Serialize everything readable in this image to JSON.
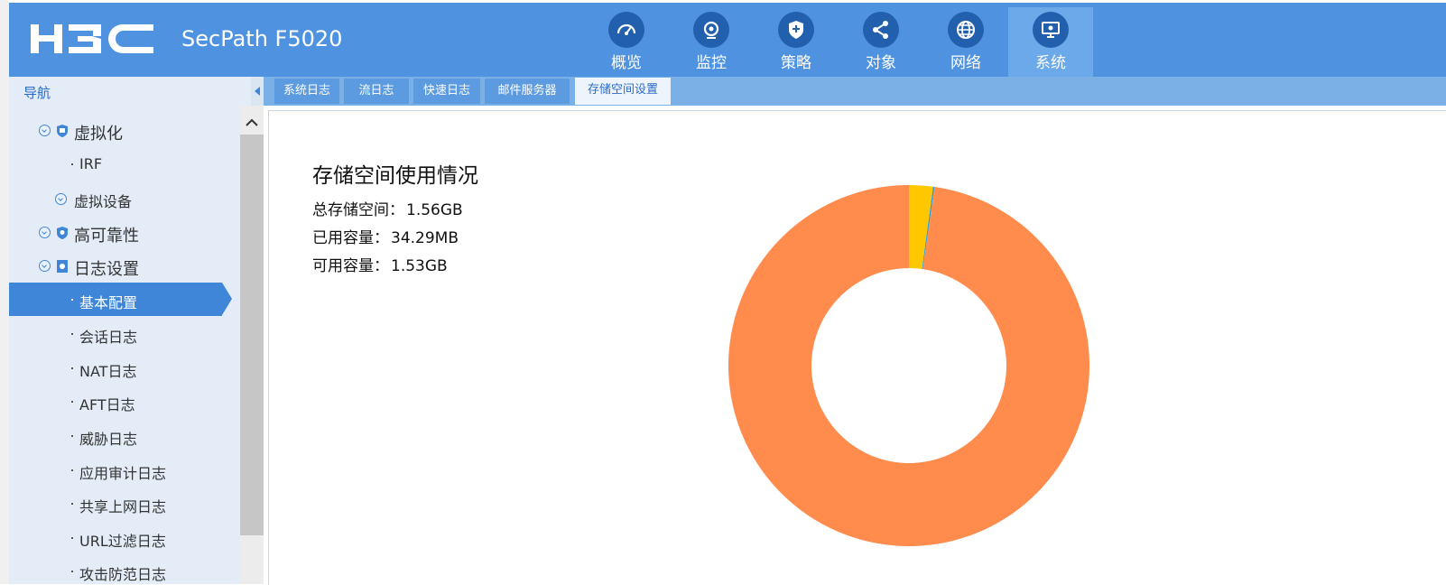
{
  "header": {
    "logo_text": "H3C",
    "product": "SecPath F5020",
    "nav": [
      {
        "label": "概览",
        "icon": "dashboard-icon"
      },
      {
        "label": "监控",
        "icon": "monitor-icon"
      },
      {
        "label": "策略",
        "icon": "shield-icon"
      },
      {
        "label": "对象",
        "icon": "share-icon"
      },
      {
        "label": "网络",
        "icon": "globe-icon"
      },
      {
        "label": "系统",
        "icon": "system-icon",
        "active": true
      }
    ]
  },
  "sidebar": {
    "title": "导航",
    "items": [
      {
        "label": "虚拟化",
        "type": "group"
      },
      {
        "label": "IRF",
        "type": "leaf"
      },
      {
        "label": "虚拟设备",
        "type": "subgroup"
      },
      {
        "label": "高可靠性",
        "type": "group"
      },
      {
        "label": "日志设置",
        "type": "group"
      },
      {
        "label": "基本配置",
        "type": "leaf",
        "active": true
      },
      {
        "label": "会话日志",
        "type": "leaf"
      },
      {
        "label": "NAT日志",
        "type": "leaf"
      },
      {
        "label": "AFT日志",
        "type": "leaf"
      },
      {
        "label": "威胁日志",
        "type": "leaf"
      },
      {
        "label": "应用审计日志",
        "type": "leaf"
      },
      {
        "label": "共享上网日志",
        "type": "leaf"
      },
      {
        "label": "URL过滤日志",
        "type": "leaf"
      },
      {
        "label": "攻击防范日志",
        "type": "leaf"
      }
    ]
  },
  "tabs": [
    {
      "label": "系统日志"
    },
    {
      "label": "流日志"
    },
    {
      "label": "快速日志"
    },
    {
      "label": "邮件服务器"
    },
    {
      "label": "存储空间设置",
      "active": true
    }
  ],
  "storage": {
    "title": "存储空间使用情况",
    "total_label": "总存储空间：",
    "total_value": "1.56GB",
    "used_label": "已用容量：",
    "used_value": "34.29MB",
    "free_label": "可用容量：",
    "free_value": "1.53GB"
  },
  "chart_data": {
    "type": "pie",
    "donut": true,
    "slices": [
      {
        "value": 1.53,
        "unit": "GB",
        "color": "#ff8c4c"
      },
      {
        "value": 0.0335,
        "unit": "GB",
        "color": "#ffc700"
      },
      {
        "value": 0.002,
        "unit": "GB",
        "color": "#2a9fd6"
      }
    ]
  },
  "colors": {
    "header": "#4f93e0",
    "nav_active": "#6ba9ea",
    "accent": "#3f86d8"
  }
}
